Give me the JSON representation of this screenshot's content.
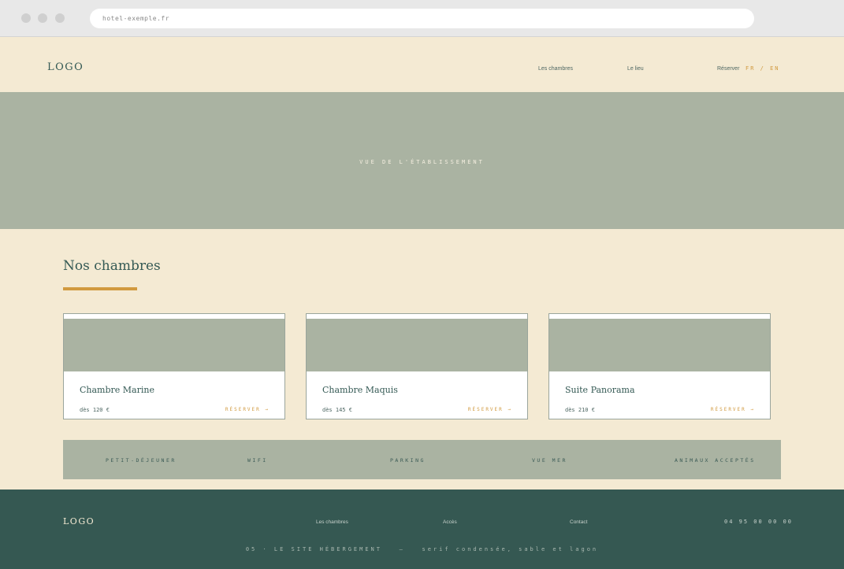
{
  "browser": {
    "url": "hotel-exemple.fr"
  },
  "header": {
    "logo": "LOGO",
    "nav": [
      "Les chambres",
      "Le lieu",
      "Réserver"
    ],
    "lang": "FR / EN"
  },
  "hero": {
    "placeholder": "VUE DE L'ÉTABLISSEMENT"
  },
  "rooms_section": {
    "title": "Nos chambres",
    "rooms": [
      {
        "name": "Chambre Marine",
        "price": "dès 120 €",
        "cta": "RÉSERVER →"
      },
      {
        "name": "Chambre Maquis",
        "price": "dès 145 €",
        "cta": "RÉSERVER →"
      },
      {
        "name": "Suite Panorama",
        "price": "dès 210 €",
        "cta": "RÉSERVER →"
      }
    ]
  },
  "amenities": [
    "PETIT-DÉJEUNER",
    "WIFI",
    "PARKING",
    "VUE MER",
    "ANIMAUX ACCEPTÉS"
  ],
  "footer": {
    "logo": "LOGO",
    "links": [
      "Les chambres",
      "Accès",
      "Contact"
    ],
    "phone": "04 95 00 00 00",
    "tagline": "05 · LE SITE HÉBERGEMENT   —   serif condensée, sable et lagon"
  },
  "colors": {
    "sand": "#f4ead3",
    "sage": "#aab3a2",
    "lagoon": "#355852",
    "accent": "#d19a3f"
  }
}
